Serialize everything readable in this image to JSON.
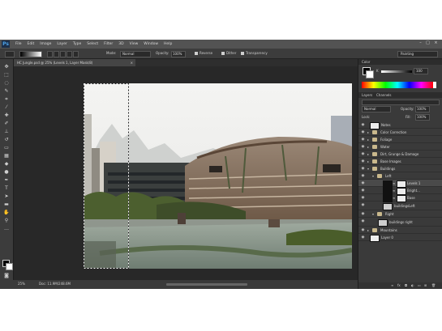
{
  "app": {
    "logo": "Ps"
  },
  "menu": [
    "File",
    "Edit",
    "Image",
    "Layer",
    "Type",
    "Select",
    "Filter",
    "3D",
    "View",
    "Window",
    "Help"
  ],
  "options": {
    "mode_label": "Mode:",
    "mode_value": "Normal",
    "opacity_label": "Opacity:",
    "opacity_value": "100%",
    "checkbox_1": "Reverse",
    "checkbox_2": "Dither",
    "checkbox_3": "Transparency",
    "workspace": "Painting"
  },
  "document": {
    "tab_title": "HC Jungle.psd @ 25% (Levels 1, Layer Mask/8)"
  },
  "status": {
    "zoom": "25%",
    "doc_info": "Doc: 11.9M/248.6M"
  },
  "panels": {
    "color_tab": "Color",
    "color_value": "100",
    "layers_tab": "Layers",
    "channels_tab": "Channels",
    "blend_mode": "Normal",
    "opacity_label": "Opacity:",
    "opacity_value": "100%",
    "fill_label": "Fill:",
    "fill_value": "100%",
    "lock_label": "Lock:"
  },
  "layers": [
    {
      "name": "Notes",
      "kind": "thumb"
    },
    {
      "name": "Color Correction",
      "kind": "folder"
    },
    {
      "name": "Foliage",
      "kind": "folder"
    },
    {
      "name": "Water",
      "kind": "folder"
    },
    {
      "name": "Dirt, Grunge & Damage",
      "kind": "folder"
    },
    {
      "name": "Base Images",
      "kind": "folder"
    },
    {
      "name": "Buildings",
      "kind": "folder"
    },
    {
      "name": "Left",
      "kind": "folder"
    },
    {
      "name": "Levels 1",
      "kind": "adjust"
    },
    {
      "name": "Bright...",
      "kind": "adjust"
    },
    {
      "name": "Base",
      "kind": "adjust"
    },
    {
      "name": "buildingsLeft",
      "kind": "thumb"
    },
    {
      "name": "Right",
      "kind": "folder"
    },
    {
      "name": "buildings right",
      "kind": "thumb"
    },
    {
      "name": "Mountains",
      "kind": "folder"
    },
    {
      "name": "Layer 0",
      "kind": "thumb"
    }
  ],
  "icons": {
    "eye": "eye-icon",
    "folder": "folder-icon",
    "chain": "chain-icon",
    "move": "move-tool-icon",
    "marquee": "marquee-tool-icon",
    "lasso": "lasso-tool-icon",
    "brush": "brush-tool-icon"
  }
}
